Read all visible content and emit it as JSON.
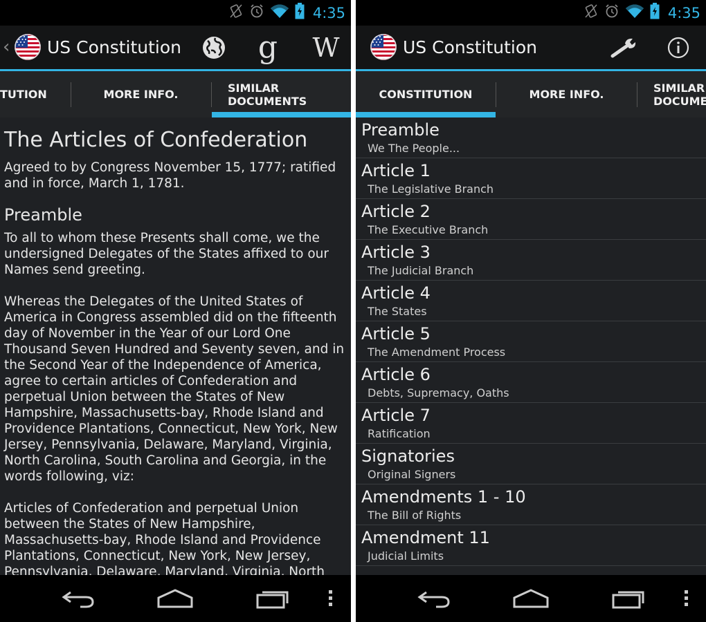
{
  "status": {
    "time": "4:35"
  },
  "colors": {
    "accent": "#33b5e5",
    "background": "#1f2124",
    "actionbar": "#141516"
  },
  "left": {
    "back_glyph": "‹",
    "app_title": "US Constitution",
    "icons": [
      "globe-icon",
      "google-icon",
      "wikipedia-icon"
    ],
    "google_glyph": "g",
    "wiki_glyph": "W",
    "tabs": [
      {
        "label": "TUTION"
      },
      {
        "label": "MORE INFO."
      },
      {
        "label_line1": "SIMILAR",
        "label_line2": "DOCUMENTS",
        "selected": true
      }
    ],
    "document": {
      "title": "The Articles of Confederation",
      "subtitle": "Agreed to by Congress November 15, 1777; ratified and in force, March 1, 1781.",
      "section_heading": "Preamble",
      "paragraph1": "To all to whom these Presents shall come, we the undersigned Delegates of the States affixed to our Names send greeting.",
      "paragraph2": "Whereas the Delegates of the United States of America in Congress assembled did on the fifteenth day of November in the Year of our Lord One Thousand Seven Hundred and Seventy seven, and in the Second Year of the Independence of America, agree to certain articles of Confederation and perpetual Union between the States of New Hampshire, Massachusetts-bay, Rhode Island and Providence Plantations, Connecticut, New York, New Jersey, Pennsylvania, Delaware, Maryland, Virginia, North Carolina, South Carolina and Georgia, in the words following, viz:",
      "paragraph3": "Articles of Confederation and perpetual Union between the States of New Hampshire, Massachusetts-bay, Rhode Island and Providence Plantations, Connecticut, New York, New Jersey, Pennsylvania, Delaware, Maryland, Virginia, North Carolina, South Carolina and Georgia."
    }
  },
  "right": {
    "app_title": "US Constitution",
    "icons": [
      "wrench-icon",
      "info-icon"
    ],
    "tabs": [
      {
        "label": "CONSTITUTION",
        "selected": true
      },
      {
        "label": "MORE INFO."
      },
      {
        "label_line1": "SIMILAR",
        "label_line2": "DOCUMEN"
      }
    ],
    "items": [
      {
        "title": "Preamble",
        "subtitle": "We The People..."
      },
      {
        "title": "Article 1",
        "subtitle": "The Legislative Branch"
      },
      {
        "title": "Article 2",
        "subtitle": "The Executive Branch"
      },
      {
        "title": "Article 3",
        "subtitle": "The Judicial Branch"
      },
      {
        "title": "Article 4",
        "subtitle": "The States"
      },
      {
        "title": "Article 5",
        "subtitle": "The Amendment Process"
      },
      {
        "title": "Article 6",
        "subtitle": "Debts, Supremacy, Oaths"
      },
      {
        "title": "Article 7",
        "subtitle": "Ratification"
      },
      {
        "title": "Signatories",
        "subtitle": "Original Signers"
      },
      {
        "title": "Amendments 1 - 10",
        "subtitle": "The Bill of Rights"
      },
      {
        "title": "Amendment 11",
        "subtitle": "Judicial Limits"
      }
    ]
  },
  "navbar": {
    "buttons": [
      "back-icon",
      "home-icon",
      "recent-apps-icon",
      "overflow-menu-icon"
    ]
  }
}
